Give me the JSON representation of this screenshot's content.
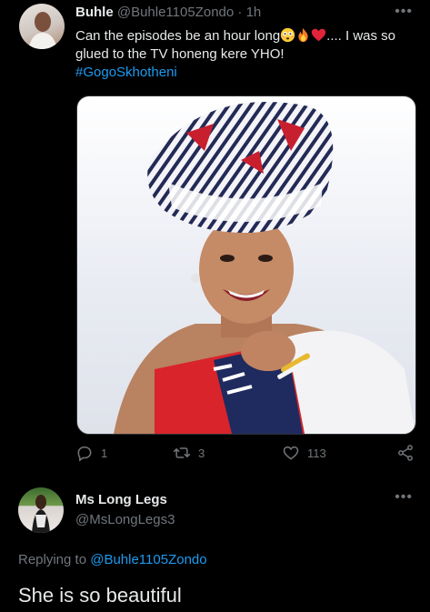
{
  "tweet": {
    "display_name": "Buhle",
    "handle": "@Buhle1105Zondo",
    "separator": "·",
    "time": "1h",
    "more_icon": "more-horizontal-icon",
    "text_before_emoji": "Can the episodes be an hour long",
    "emojis": [
      "flushed-face-emoji",
      "fire-emoji",
      "red-heart-emoji"
    ],
    "text_after_emoji": ".... I was so glued to the TV honeng kere YHO!",
    "hashtag": "#GogoSkhotheni",
    "actions": {
      "reply_count": "1",
      "retweet_count": "3",
      "like_count": "113"
    }
  },
  "reply": {
    "display_name": "Ms Long Legs",
    "handle": "@MsLongLegs3",
    "more_icon": "more-horizontal-icon",
    "replying_prefix": "Replying to",
    "replying_to": "@Buhle1105Zondo",
    "text": "She is so beautiful"
  },
  "colors": {
    "background": "#000000",
    "text": "#e7e9ea",
    "muted": "#71767b",
    "link": "#1d9bf0"
  }
}
